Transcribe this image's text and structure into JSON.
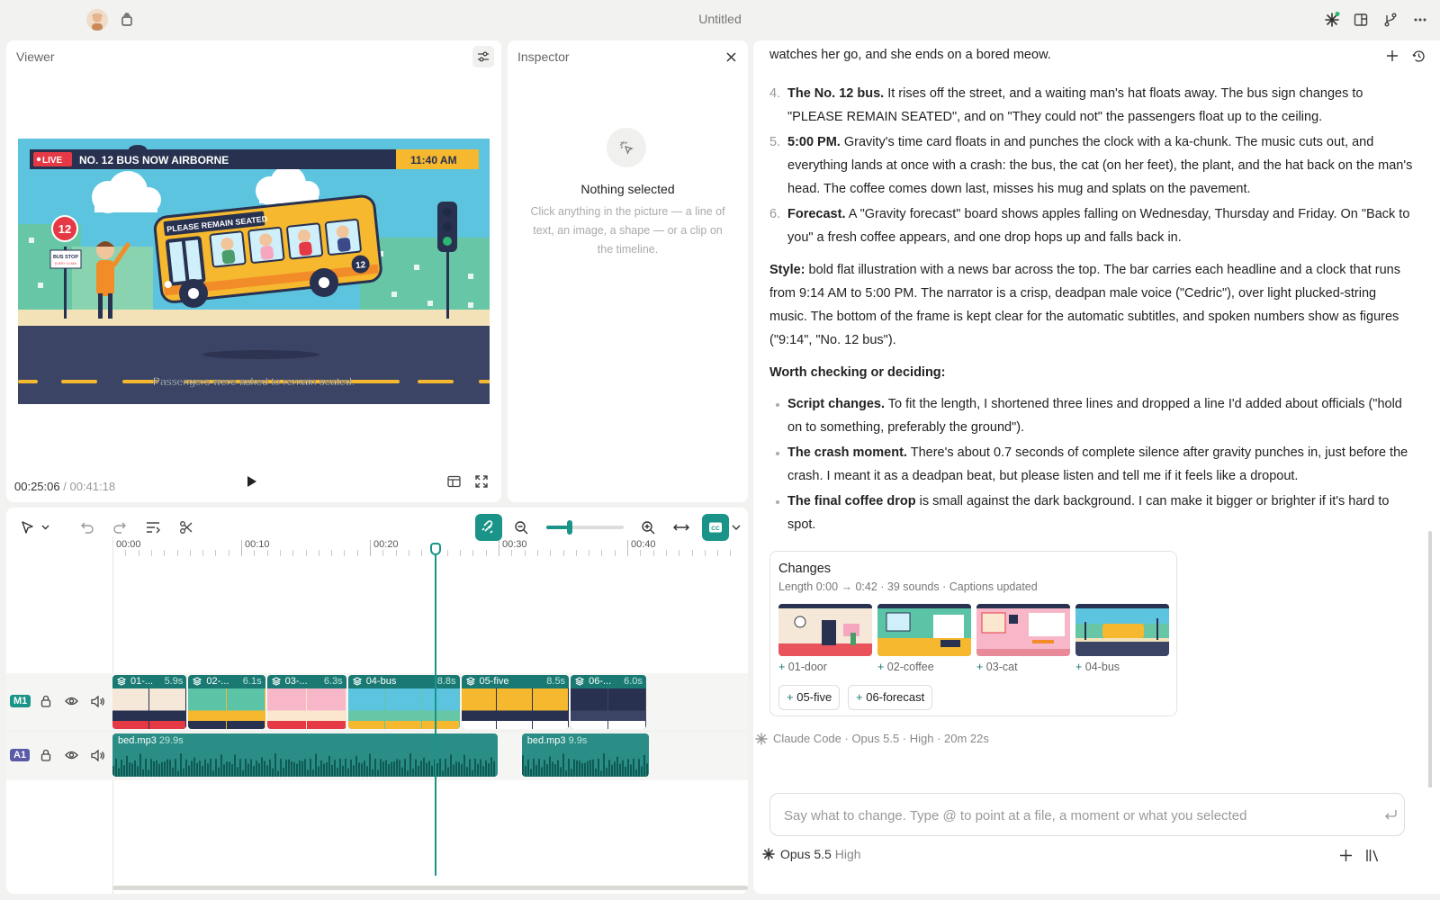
{
  "app": {
    "title": "Untitled",
    "accent": "#1a7a73",
    "icons": [
      "avatar",
      "layers-icon",
      "claude-spark-icon",
      "layout-icon",
      "branch-icon",
      "more-icon"
    ]
  },
  "viewer": {
    "title": "Viewer",
    "current_time": "00:25:06",
    "separator": "/",
    "duration": "00:41:18",
    "frame": {
      "live_label": "LIVE",
      "headline": "NO. 12 BUS NOW AIRBORNE",
      "clock": "11:40 AM",
      "bus_sign": "PLEASE REMAIN SEATED",
      "bus_number": "12",
      "stop_sign_number": "12",
      "stop_sign_line1": "BUS STOP",
      "stop_sign_line2": "EVERY 10 MIN",
      "subtitle": "Passengers were asked to remain seated."
    }
  },
  "inspector": {
    "title": "Inspector",
    "empty_title": "Nothing selected",
    "empty_desc": "Click anything in the picture — a line of text, an image, a shape — or a clip on the timeline."
  },
  "timeline": {
    "ruler": [
      "00:00",
      "00:10",
      "00:20",
      "00:30",
      "00:40"
    ],
    "playhead_seconds": 25.1,
    "zoom_level": 0.3,
    "tracks": {
      "video_badge": "M1",
      "audio_badge": "A1"
    },
    "video_clips": [
      {
        "name": "01-...",
        "duration": "5.9s"
      },
      {
        "name": "02-...",
        "duration": "6.1s"
      },
      {
        "name": "03-...",
        "duration": "6.3s"
      },
      {
        "name": "04-bus",
        "duration": "8.8s"
      },
      {
        "name": "05-five",
        "duration": "8.5s"
      },
      {
        "name": "06-...",
        "duration": "6.0s"
      }
    ],
    "audio_clips": [
      {
        "name": "bed.mp3",
        "duration": "29.9s"
      },
      {
        "name": "bed.mp3",
        "duration": "9.9s"
      }
    ]
  },
  "chat": {
    "top_cut": "watches her go, and she ends on a bored meow.",
    "steps": [
      {
        "num": "4.",
        "bold": "The No. 12 bus.",
        "text": " It rises off the street, and a waiting man's hat floats away. The bus sign changes to \"PLEASE REMAIN SEATED\", and on \"They could not\" the passengers float up to the ceiling."
      },
      {
        "num": "5.",
        "bold": "5:00 PM.",
        "text": " Gravity's time card floats in and punches the clock with a ka-chunk. The music cuts out, and everything lands at once with a crash: the bus, the cat (on her feet), the plant, and the hat back on the man's head. The coffee comes down last, misses his mug and splats on the pavement."
      },
      {
        "num": "6.",
        "bold": "Forecast.",
        "text": " A \"Gravity forecast\" board shows apples falling on Wednesday, Thursday and Friday. On \"Back to you\" a fresh coffee appears, and one drop hops up and falls back in."
      }
    ],
    "style_label": "Style:",
    "style_text": " bold flat illustration with a news bar across the top. The bar carries each headline and a clock that runs from 9:14 AM to 5:00 PM. The narrator is a crisp, deadpan male voice (\"Cedric\"), over light plucked-string music. The bottom of the frame is kept clear for the automatic subtitles, and spoken numbers show as figures (\"9:14\", \"No. 12 bus\").",
    "worth_heading": "Worth checking or deciding:",
    "bullets": [
      {
        "bold": "Script changes.",
        "text": " To fit the length, I shortened three lines and dropped a line I'd added about officials (\"hold on to something, preferably the ground\")."
      },
      {
        "bold": "The crash moment.",
        "text": " There's about 0.7 seconds of complete silence after gravity punches in, just before the crash. I meant it as a deadpan beat, but please listen and tell me if it feels like a dropout."
      },
      {
        "bold": "The final coffee drop",
        "text": " is small against the dark background. I can make it bigger or brighter if it's hard to spot."
      }
    ],
    "changes": {
      "title": "Changes",
      "summary": "Length 0:00 → 0:42 · 39 sounds · Captions updated",
      "plus": "+",
      "items": [
        "01-door",
        "02-coffee",
        "03-cat",
        "04-bus"
      ],
      "pills": [
        "05-five",
        "06-forecast"
      ]
    },
    "model_line": "Claude Code · Opus 5.5 · High · 20m 22s",
    "input_placeholder": "Say what to change. Type @ to point at a file, a moment or what you selected",
    "model": "Opus 5.5",
    "effort": "High"
  }
}
